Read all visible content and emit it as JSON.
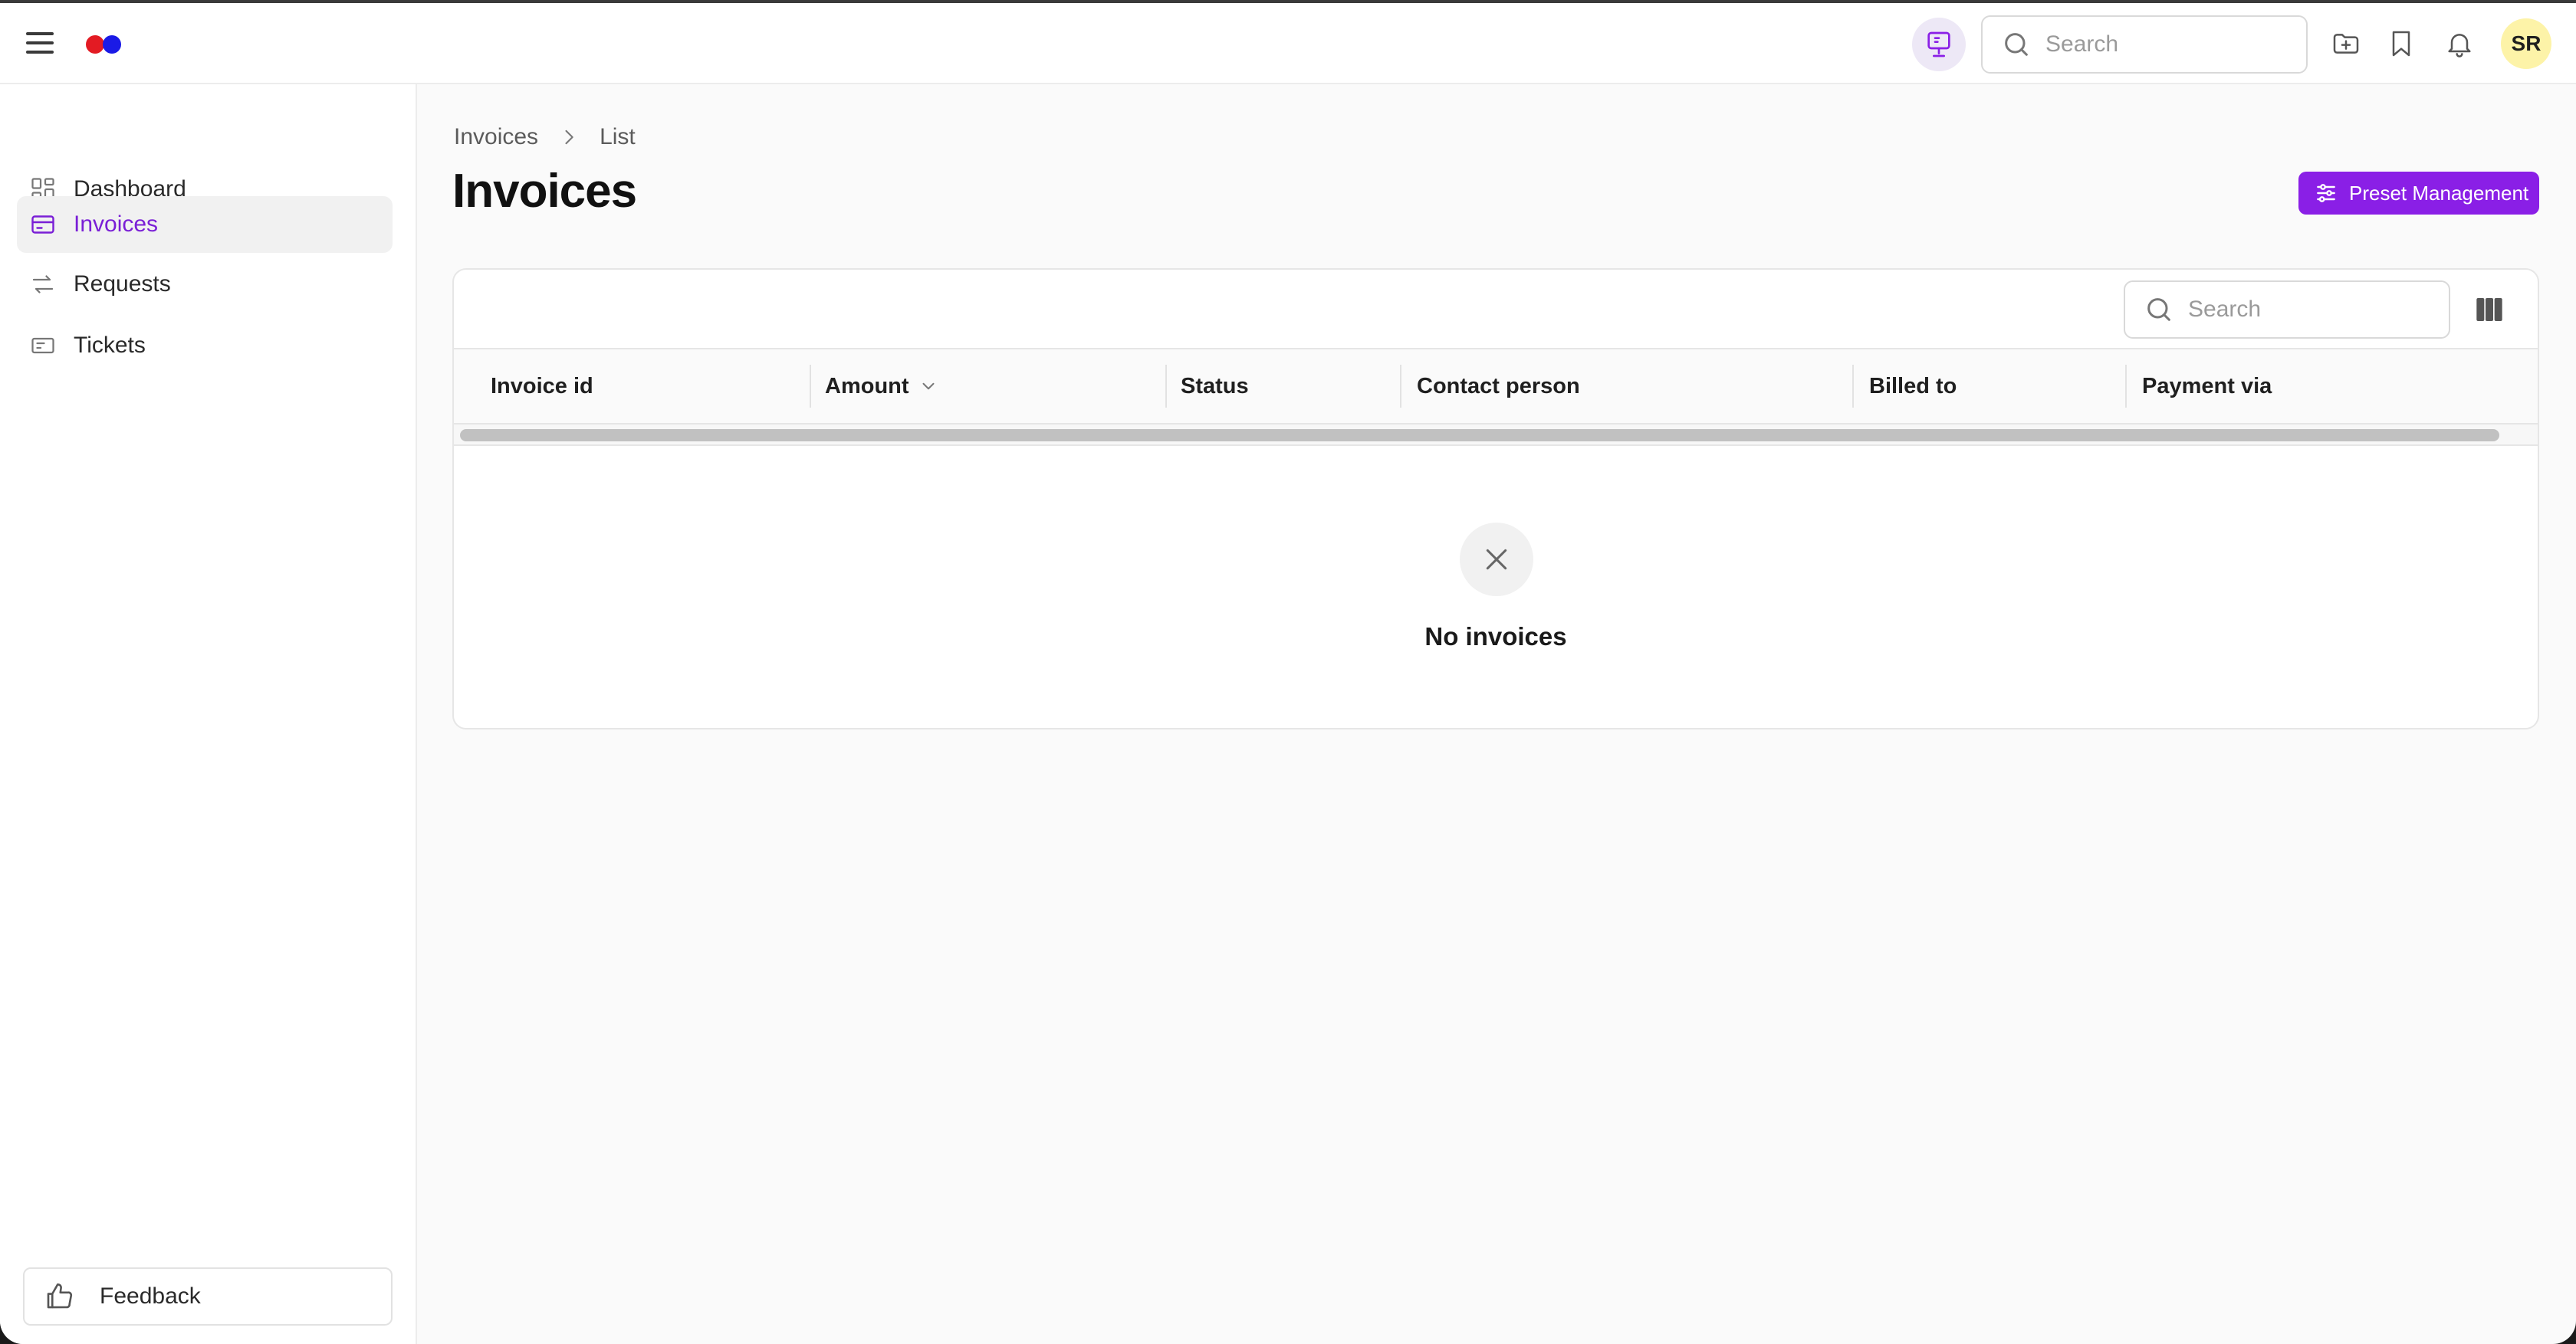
{
  "topbar": {
    "search_placeholder": "Search",
    "avatar_initials": "SR",
    "icons": [
      "menu-icon",
      "screen-share-icon",
      "search-icon",
      "folder-add-icon",
      "bookmark-icon",
      "bell-icon"
    ]
  },
  "sidebar": {
    "items": [
      {
        "label": "Dashboard",
        "icon": "dashboard-icon",
        "active": false
      },
      {
        "label": "Invoices",
        "icon": "invoice-icon",
        "active": true
      },
      {
        "label": "Requests",
        "icon": "arrows-swap-icon",
        "active": false
      },
      {
        "label": "Tickets",
        "icon": "ticket-icon",
        "active": false
      }
    ],
    "feedback_label": "Feedback"
  },
  "breadcrumb": [
    "Invoices",
    "List"
  ],
  "page": {
    "title": "Invoices",
    "preset_button": "Preset Management"
  },
  "table": {
    "search_placeholder": "Search",
    "columns": [
      "Invoice id",
      "Amount",
      "Status",
      "Contact person",
      "Billed to",
      "Payment via"
    ],
    "empty_text": "No invoices"
  },
  "colors": {
    "accent": "#8a1fe6",
    "active_nav_text": "#7a1fd6",
    "logo_red": "#e31b23",
    "logo_blue": "#1a1ae6",
    "avatar_bg": "#fdf3a8"
  }
}
